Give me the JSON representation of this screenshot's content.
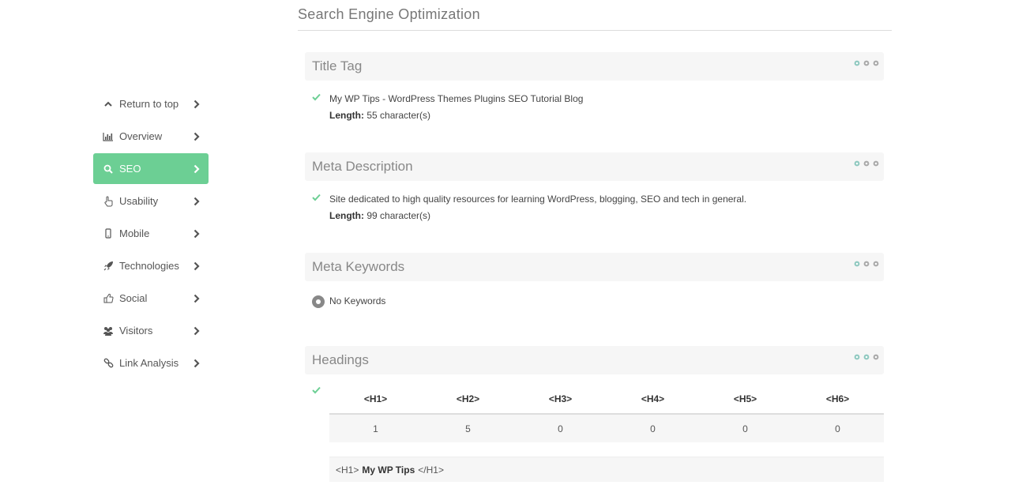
{
  "page_title": "Search Engine Optimization",
  "sidebar": {
    "items": [
      {
        "label": "Return to top",
        "icon": "chevron-up-icon",
        "active": false
      },
      {
        "label": "Overview",
        "icon": "bar-chart-icon",
        "active": false
      },
      {
        "label": "SEO",
        "icon": "search-icon",
        "active": true
      },
      {
        "label": "Usability",
        "icon": "hand-pointer-icon",
        "active": false
      },
      {
        "label": "Mobile",
        "icon": "mobile-icon",
        "active": false
      },
      {
        "label": "Technologies",
        "icon": "rocket-icon",
        "active": false
      },
      {
        "label": "Social",
        "icon": "thumbs-up-icon",
        "active": false
      },
      {
        "label": "Visitors",
        "icon": "users-icon",
        "active": false
      },
      {
        "label": "Link Analysis",
        "icon": "link-icon",
        "active": false
      }
    ]
  },
  "sections": {
    "title_tag": {
      "heading": "Title Tag",
      "value": "My WP Tips - WordPress Themes Plugins SEO Tutorial Blog",
      "length_label": "Length:",
      "length_value": "55 character(s)"
    },
    "meta_description": {
      "heading": "Meta Description",
      "value": "Site dedicated to high quality resources for learning WordPress, blogging, SEO and tech in general.",
      "length_label": "Length:",
      "length_value": "99 character(s)"
    },
    "meta_keywords": {
      "heading": "Meta Keywords",
      "value": "No Keywords"
    },
    "headings": {
      "heading": "Headings",
      "columns": [
        "<H1>",
        "<H2>",
        "<H3>",
        "<H4>",
        "<H5>",
        "<H6>"
      ],
      "counts": [
        "1",
        "5",
        "0",
        "0",
        "0",
        "0"
      ],
      "h1_open": "<H1>",
      "h1_text": "My WP Tips",
      "h1_close": "</H1>"
    }
  },
  "colors": {
    "accent": "#6ccf94",
    "gear": "#8fc9c0"
  }
}
